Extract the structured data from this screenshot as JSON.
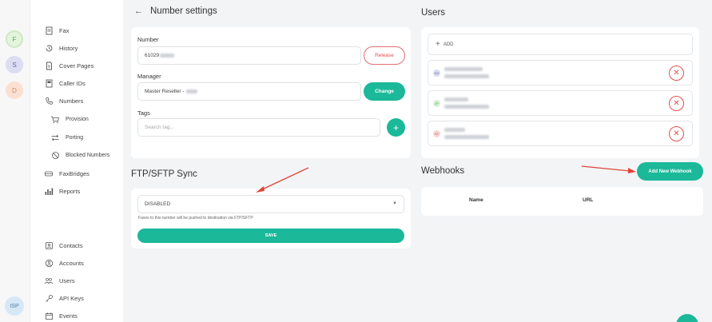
{
  "rail": {
    "avatars": [
      "F",
      "S",
      "D"
    ],
    "bottom_avatar": "ISP"
  },
  "sidebar": {
    "items": [
      {
        "label": "Fax",
        "icon": "fax-icon"
      },
      {
        "label": "History",
        "icon": "history-icon"
      },
      {
        "label": "Cover Pages",
        "icon": "cover-pages-icon"
      },
      {
        "label": "Caller IDs",
        "icon": "caller-ids-icon"
      },
      {
        "label": "Numbers",
        "icon": "phone-icon"
      },
      {
        "label": "Provision",
        "icon": "cart-icon"
      },
      {
        "label": "Porting",
        "icon": "porting-icon"
      },
      {
        "label": "Blocked Numbers",
        "icon": "block-icon"
      },
      {
        "label": "FaxBridges",
        "icon": "faxbridge-icon"
      },
      {
        "label": "Reports",
        "icon": "reports-icon"
      },
      {
        "label": "Contacts",
        "icon": "contacts-icon"
      },
      {
        "label": "Accounts",
        "icon": "accounts-icon"
      },
      {
        "label": "Users",
        "icon": "users-icon"
      },
      {
        "label": "API Keys",
        "icon": "key-icon"
      },
      {
        "label": "Events",
        "icon": "calendar-icon"
      }
    ]
  },
  "number_settings": {
    "title": "Number settings",
    "number_label": "Number",
    "number_value": "61029",
    "release_label": "Release",
    "manager_label": "Manager",
    "manager_value": "Master Reseller -",
    "change_label": "Change",
    "tags_label": "Tags",
    "tags_placeholder": "Search tag...",
    "add_tag_label": "+"
  },
  "ftp": {
    "title": "FTP/SFTP Sync",
    "select_value": "DISABLED",
    "help_text": "Faxes to this number will be pushed to destination via FTP/SFTP",
    "save_label": "SAVE"
  },
  "users": {
    "title": "Users",
    "add_label": "ADD",
    "rows": [
      {
        "initials": "DH",
        "color": "#d9dbef",
        "text_color": "#6f6fa8"
      },
      {
        "initials": "JP",
        "color": "#d8f0d6",
        "text_color": "#4aa34a"
      },
      {
        "initials": "ST",
        "color": "#f8d6d6",
        "text_color": "#d05050"
      }
    ]
  },
  "webhooks": {
    "title": "Webhooks",
    "add_label": "Add New Webhook",
    "columns": [
      "Name",
      "URL"
    ]
  },
  "colors": {
    "accent": "#1bb89a",
    "danger": "#e05050",
    "arrow": "#e0443a"
  }
}
